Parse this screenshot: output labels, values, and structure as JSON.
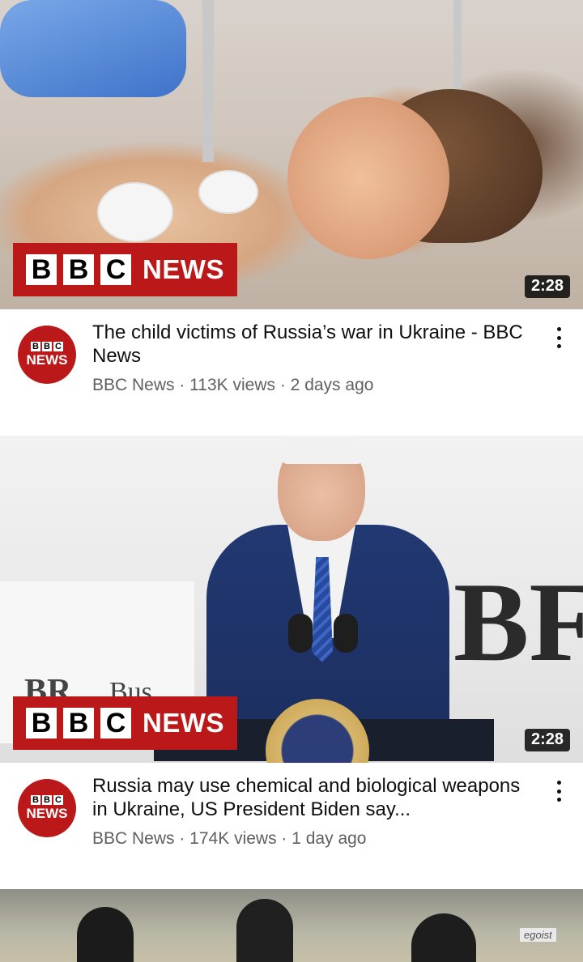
{
  "feed": {
    "videos": [
      {
        "thumbnail_overlay": {
          "logo_letters": [
            "B",
            "B",
            "C"
          ],
          "logo_word": "NEWS"
        },
        "duration": "2:28",
        "channel_avatar": {
          "letters": [
            "B",
            "B",
            "C"
          ],
          "word": "NEWS"
        },
        "title": "The child victims of Russia’s war in Ukraine - BBC News",
        "subtitle": "BBC News · 113K views · 2 days ago"
      },
      {
        "thumbnail_overlay": {
          "logo_letters": [
            "B",
            "B",
            "C"
          ],
          "logo_word": "NEWS"
        },
        "duration": "2:28",
        "channel_avatar": {
          "letters": [
            "B",
            "B",
            "C"
          ],
          "word": "NEWS"
        },
        "title": "Russia may use chemical and biological weapons in Ukraine, US President Biden say...",
        "subtitle": "BBC News · 174K views · 1 day ago"
      }
    ],
    "partial_thumbnail_text": "egoist"
  },
  "colors": {
    "bbc_red": "#bb1919",
    "meta_gray": "#606060",
    "title_black": "#0f0f0f"
  },
  "icons": {
    "more": "vertical-ellipsis-icon"
  }
}
